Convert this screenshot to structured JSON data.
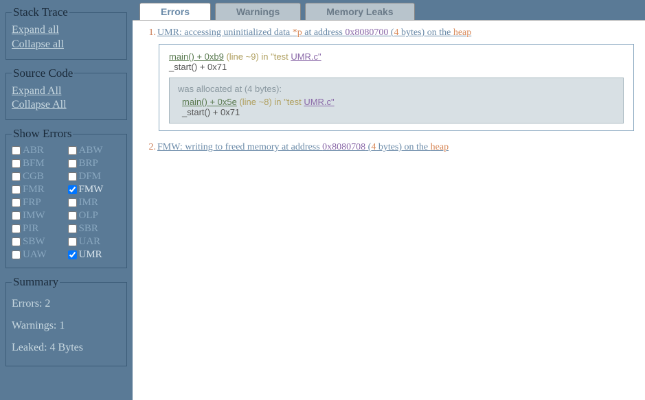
{
  "sidebar": {
    "stackTrace": {
      "legend": "Stack Trace",
      "expand": "Expand all",
      "collapse": "Collapse all"
    },
    "sourceCode": {
      "legend": "Source Code",
      "expand": "Expand All",
      "collapse": "Collapse All"
    },
    "showErrors": {
      "legend": "Show Errors",
      "items": [
        {
          "code": "ABR",
          "checked": false
        },
        {
          "code": "ABW",
          "checked": false
        },
        {
          "code": "BFM",
          "checked": false
        },
        {
          "code": "BRP",
          "checked": false
        },
        {
          "code": "CGB",
          "checked": false
        },
        {
          "code": "DFM",
          "checked": false
        },
        {
          "code": "FMR",
          "checked": false
        },
        {
          "code": "FMW",
          "checked": true
        },
        {
          "code": "FRP",
          "checked": false
        },
        {
          "code": "IMR",
          "checked": false
        },
        {
          "code": "IMW",
          "checked": false
        },
        {
          "code": "OLP",
          "checked": false
        },
        {
          "code": "PIR",
          "checked": false
        },
        {
          "code": "SBR",
          "checked": false
        },
        {
          "code": "SBW",
          "checked": false
        },
        {
          "code": "UAR",
          "checked": false
        },
        {
          "code": "UAW",
          "checked": false
        },
        {
          "code": "UMR",
          "checked": true
        }
      ]
    },
    "summary": {
      "legend": "Summary",
      "errors": "Errors: 2",
      "warnings": "Warnings: 1",
      "leaked": "Leaked: 4 Bytes"
    }
  },
  "tabs": {
    "errors": "Errors",
    "warnings": "Warnings",
    "leaks": "Memory Leaks"
  },
  "errors": [
    {
      "num": "1.",
      "pre": "UMR: accessing uninitialized data ",
      "ptr": "*p",
      "mid": " at address ",
      "addr": "0x8080700",
      "bopen": " (",
      "bytes": "4",
      "bafter": " bytes) on the ",
      "heap": "heap",
      "frames": [
        {
          "fn": "main() + 0xb9",
          "meta": " (line ~9) in \"test  ",
          "file": "UMR.c\""
        },
        {
          "plain": "_start() + 0x71"
        }
      ],
      "alloc": {
        "head": "was allocated at (4 bytes):",
        "frames": [
          {
            "fn": "main() + 0x5e",
            "meta": " (line ~8) in \"test  ",
            "file": "UMR.c\""
          },
          {
            "plain": "_start() + 0x71"
          }
        ]
      }
    },
    {
      "num": "2.",
      "pre": "FMW: writing to freed memory at address ",
      "ptr": "",
      "mid": "",
      "addr": "0x8080708",
      "bopen": " (",
      "bytes": "4",
      "bafter": " bytes) on the ",
      "heap": "heap"
    }
  ]
}
